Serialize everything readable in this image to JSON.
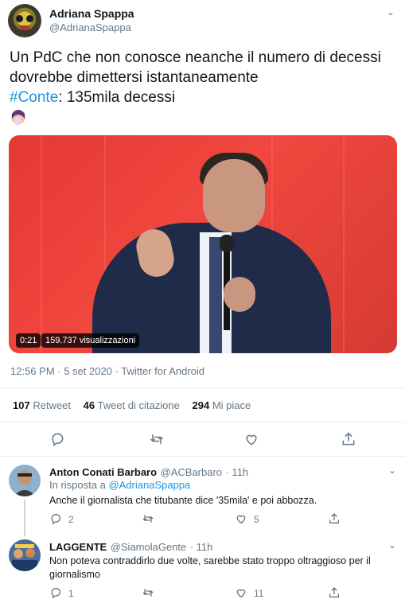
{
  "author": {
    "name": "Adriana Spappa",
    "handle": "@AdrianaSpappa",
    "avatar_icon": "skull-mask-avatar"
  },
  "menu_icon": "chevron-down-icon",
  "tweet": {
    "text_line1": "Un PdC che non conosce neanche il numero di decessi",
    "text_line2": "dovrebbe dimettersi istantaneamente",
    "hashtag": "#Conte",
    "text_line3_rest": ": 135mila decessi",
    "emoji": "woman-facepalming"
  },
  "video": {
    "duration": "0:21",
    "views": "159.737 visualizzazioni"
  },
  "meta": "12:56 PM · 5 set 2020 · Twitter for Android",
  "stats": {
    "retweets_count": "107",
    "retweets_label": "Retweet",
    "quotes_count": "46",
    "quotes_label": "Tweet di citazione",
    "likes_count": "294",
    "likes_label": "Mi piace"
  },
  "replies": [
    {
      "name": "Anton Conati Barbaro",
      "handle": "@ACBarbaro",
      "time": "· 11h",
      "in_reply_prefix": "In risposta a",
      "in_reply_handle": "@AdrianaSpappa",
      "text": "Anche il giornalista che titubante dice '35mila' e poi abbozza.",
      "reply_count": "2",
      "retweet_count": "",
      "like_count": "5"
    },
    {
      "name": "LAGGENTE",
      "handle": "@SiamolaGente",
      "time": "· 11h",
      "text_line1": "Non poteva contraddirlo due volte, sarebbe stato troppo oltraggioso per il",
      "text_line2": "giornalismo",
      "reply_count": "1",
      "retweet_count": "",
      "like_count": "11"
    }
  ]
}
